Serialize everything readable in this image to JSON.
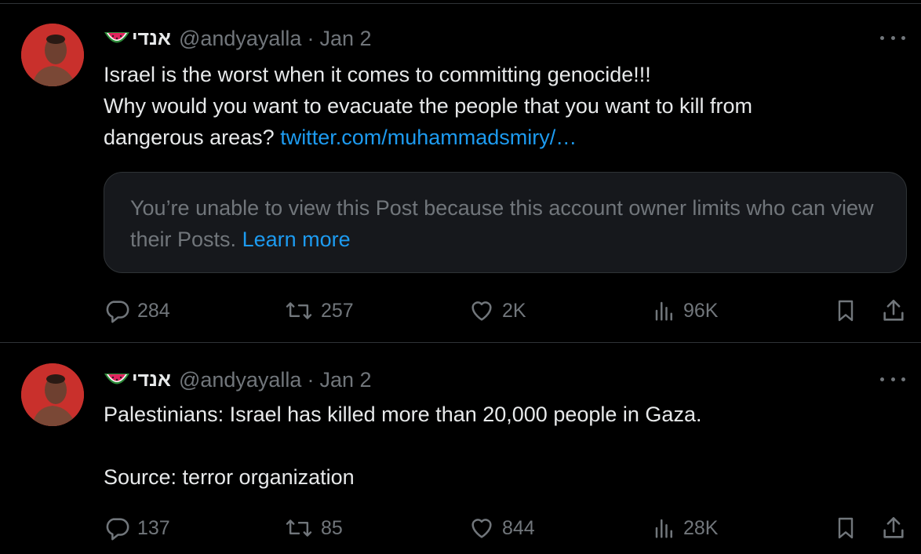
{
  "tweets": [
    {
      "display_name": "אנדי",
      "handle": "@andyayalla",
      "separator": "·",
      "date": "Jan 2",
      "text_line1": "Israel is the worst when it comes to committing genocide!!!",
      "text_line2": "Why would you want to evacuate the people that you want to kill from",
      "text_line3": "dangerous areas?",
      "link": "twitter.com/muhammadsmiry/…",
      "notice_text": "You’re unable to view this Post because this account owner limits who can view their Posts.",
      "notice_link": "Learn more",
      "replies": "284",
      "reposts": "257",
      "likes": "2K",
      "views": "96K"
    },
    {
      "display_name": "אנדי",
      "handle": "@andyayalla",
      "separator": "·",
      "date": "Jan 2",
      "text_line1": "Palestinians: Israel has killed more than 20,000 people in Gaza.",
      "text_line2": "Source: terror organization",
      "replies": "137",
      "reposts": "85",
      "likes": "844",
      "views": "28K"
    }
  ],
  "icons": {
    "emoji": "watermelon-icon",
    "more": "more-horizontal-icon",
    "reply": "reply-icon",
    "repost": "repost-icon",
    "like": "heart-icon",
    "views": "views-icon",
    "bookmark": "bookmark-icon",
    "share": "share-icon"
  },
  "colors": {
    "background": "#000000",
    "text": "#e7e9ea",
    "muted": "#71767b",
    "link": "#1d9bf0",
    "border": "#2f3336"
  }
}
